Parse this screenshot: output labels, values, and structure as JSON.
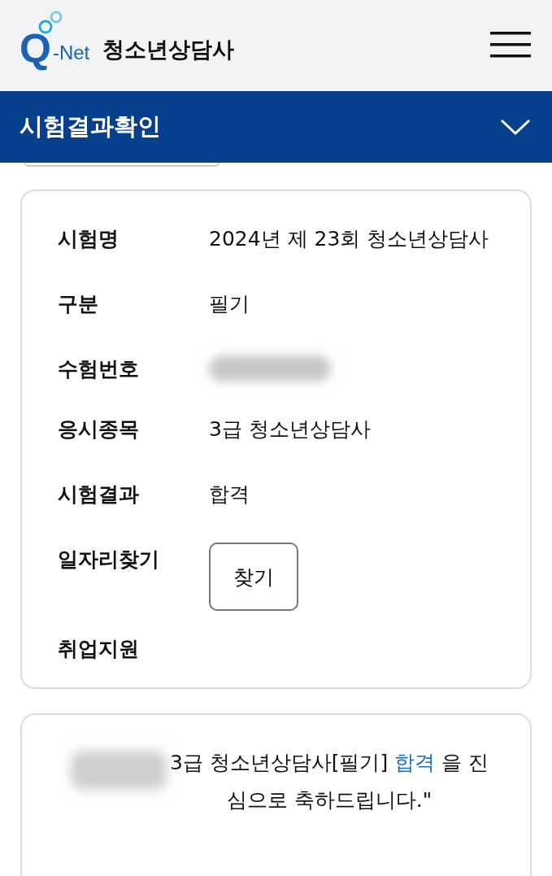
{
  "header": {
    "logo_letter": "Q",
    "logo_text": "-Net",
    "site_title": "청소년상담사"
  },
  "section_bar": {
    "title": "시험결과확인",
    "expanded": false
  },
  "result": [
    {
      "label": "시험명",
      "kind": "text",
      "value": "2024년 제 23회 청소년상담사"
    },
    {
      "label": "구분",
      "kind": "text",
      "value": "필기"
    },
    {
      "label": "수험번호",
      "kind": "blurred"
    },
    {
      "label": "응시종목",
      "kind": "text",
      "value": "3급 청소년상담사"
    },
    {
      "label": "시험결과",
      "kind": "text",
      "value": "합격"
    },
    {
      "label": "일자리찾기",
      "kind": "button",
      "value": "찾기"
    },
    {
      "label": "취업지원",
      "kind": "empty"
    }
  ],
  "message": {
    "before": "3급 청소년상담사[필기] ",
    "highlight": "합격",
    "after": " 을 진심으로 축하드립니다.\""
  }
}
